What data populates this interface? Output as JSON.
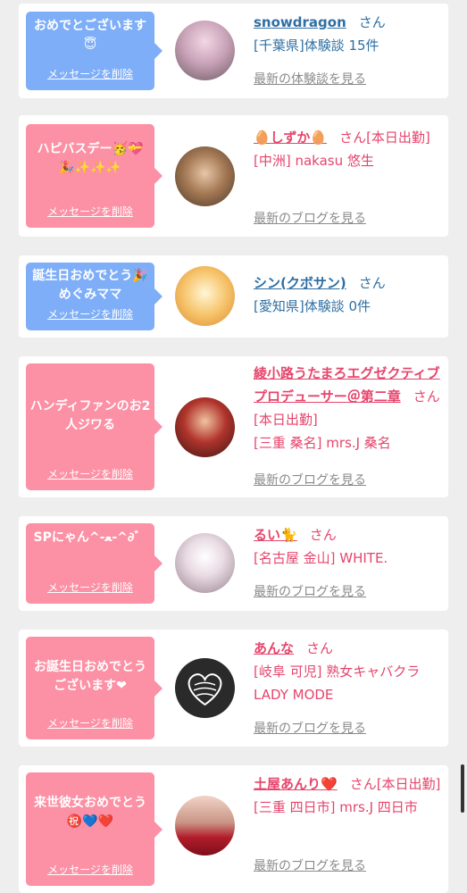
{
  "colors": {
    "background": "#eeeeee",
    "card": "#ffffff",
    "bubble_blue": "#7eaef7",
    "bubble_pink": "#fc90a4",
    "text_blue": "#2f6fa3",
    "text_pink": "#e6456c",
    "link_gray": "#8a8a8a"
  },
  "cards": [
    {
      "bubble_color": "blue",
      "message": "おめでとございます😇",
      "delete_label": "メッセージを削除",
      "name": "snowdragon",
      "honorific": "さん",
      "status": "",
      "details": [
        "[千葉県]体験談 15件"
      ],
      "latest_label": "最新の体験談を見る",
      "avatar_icon": "avatar-photo"
    },
    {
      "bubble_color": "pink",
      "message": "ハピバスデー🥳💝🎉✨✨✨",
      "delete_label": "メッセージを削除",
      "name": "🥚しずか🥚",
      "honorific": "さん",
      "status": "[本日出勤]",
      "details": [
        "[中洲] nakasu 悠生"
      ],
      "latest_label": "最新のブログを見る",
      "avatar_icon": "avatar-photo"
    },
    {
      "bubble_color": "blue",
      "message": "誕生日おめでとう🎉めぐみママ",
      "delete_label": "メッセージを削除",
      "name": "シン(クボサン)",
      "honorific": "さん",
      "status": "",
      "details": [
        "[愛知県]体験談 0件"
      ],
      "latest_label": "",
      "avatar_icon": "avatar-photo"
    },
    {
      "bubble_color": "pink",
      "message": "ハンディファンのお2人ジワる",
      "delete_label": "メッセージを削除",
      "name": "綾小路うたまろエグゼクティブプロデューサー＠第二章",
      "honorific": "さん",
      "status": "[本日出勤]",
      "details": [
        "[三重 桑名] mrs.J 桑名"
      ],
      "latest_label": "最新のブログを見る",
      "avatar_icon": "avatar-photo"
    },
    {
      "bubble_color": "pink",
      "message": "SPにゃん^-ﻌ-^∂゛",
      "delete_label": "メッセージを削除",
      "name": "るい🐈",
      "honorific": "さん",
      "status": "",
      "details": [
        "[名古屋 金山] WHITE."
      ],
      "latest_label": "最新のブログを見る",
      "avatar_icon": "avatar-photo"
    },
    {
      "bubble_color": "pink",
      "message": "お誕生日おめでとうございます❤︎",
      "delete_label": "メッセージを削除",
      "name": "あんな",
      "honorific": "さん",
      "status": "",
      "details": [
        "[岐阜 可児] 熟女キャバクラ LADY MODE"
      ],
      "latest_label": "最新のブログを見る",
      "avatar_icon": "avatar-photo"
    },
    {
      "bubble_color": "pink",
      "message": "来世彼女おめでとう㊗️💙❤️",
      "delete_label": "メッセージを削除",
      "name": "土屋あんり❤️",
      "honorific": "さん",
      "status": "[本日出勤]",
      "details": [
        "[三重 四日市] mrs.J 四日市"
      ],
      "latest_label": "最新のブログを見る",
      "avatar_icon": "avatar-photo"
    }
  ]
}
